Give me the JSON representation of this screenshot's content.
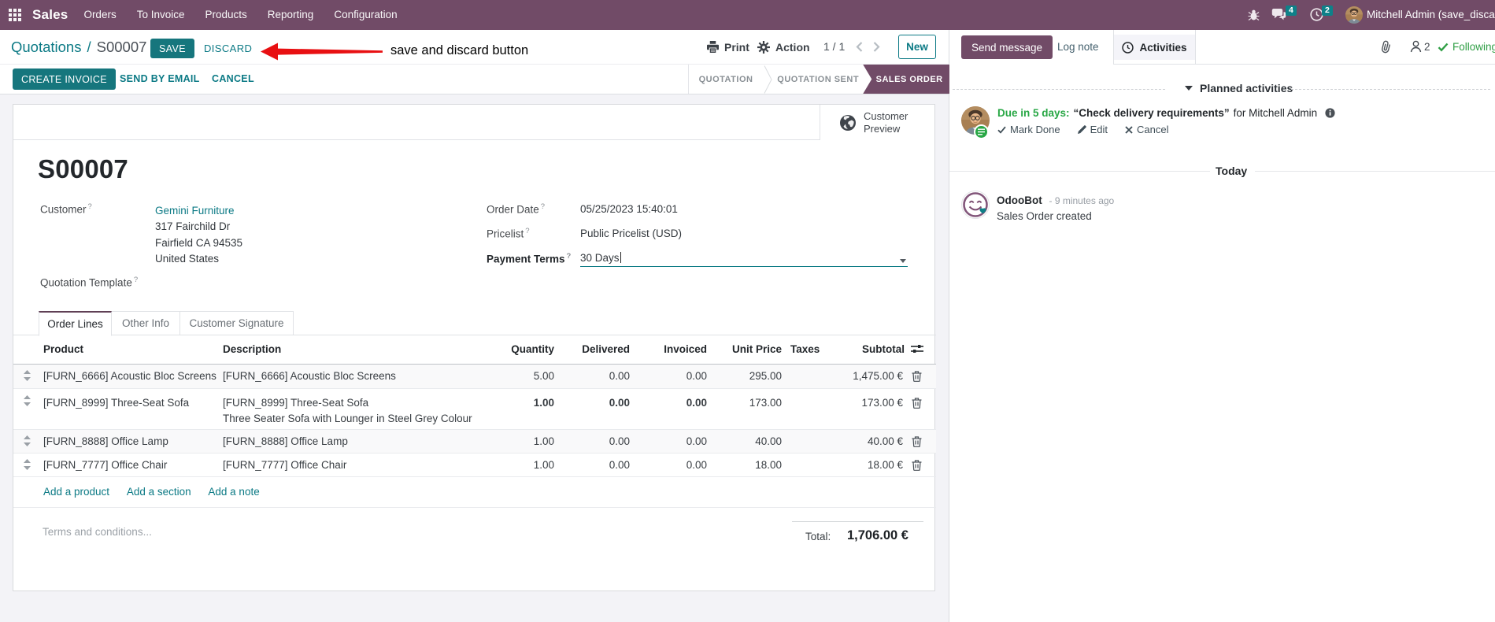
{
  "colors": {
    "brand_purple": "#714B67",
    "accent_teal": "#0c7a85",
    "button_teal": "#16767d",
    "modified_blue": "#1f87c5",
    "success_green": "#28a745",
    "annotation_red": "#e81012"
  },
  "nav": {
    "app_name": "Sales",
    "items": [
      "Orders",
      "To Invoice",
      "Products",
      "Reporting",
      "Configuration"
    ],
    "chat_badge": "4",
    "activity_badge": "2",
    "user_name": "Mitchell Admin (save_discard"
  },
  "control": {
    "breadcrumb_parent": "Quotations",
    "breadcrumb_sep": "/",
    "breadcrumb_current": "S00007",
    "save_label": "SAVE",
    "discard_label": "DISCARD",
    "print_label": "Print",
    "action_label": "Action",
    "pager": "1 / 1",
    "new_label": "New",
    "create_invoice_label": "CREATE INVOICE",
    "send_by_email_label": "SEND BY EMAIL",
    "cancel_label": "CANCEL"
  },
  "annotation": {
    "text": "save and discard button"
  },
  "statusbar": {
    "steps": [
      "QUOTATION",
      "QUOTATION SENT",
      "SALES ORDER"
    ],
    "active": "SALES ORDER"
  },
  "sheet": {
    "preview_label": "Customer Preview",
    "title": "S00007",
    "help_marker": "?",
    "customer": {
      "label": "Customer",
      "name": "Gemini Furniture",
      "address": [
        "317 Fairchild Dr",
        "Fairfield CA 94535",
        "United States"
      ]
    },
    "quotation_template_label": "Quotation Template",
    "order_date": {
      "label": "Order Date",
      "value": "05/25/2023 15:40:01"
    },
    "pricelist": {
      "label": "Pricelist",
      "value": "Public Pricelist (USD)"
    },
    "payment_terms": {
      "label": "Payment Terms",
      "value": "30 Days"
    }
  },
  "tabs": [
    "Order Lines",
    "Other Info",
    "Customer Signature"
  ],
  "table": {
    "headers": {
      "product": "Product",
      "description": "Description",
      "quantity": "Quantity",
      "delivered": "Delivered",
      "invoiced": "Invoiced",
      "unit_price": "Unit Price",
      "taxes": "Taxes",
      "subtotal": "Subtotal"
    },
    "rows": [
      {
        "product": "[FURN_6666] Acoustic Bloc Screens",
        "description": "[FURN_6666] Acoustic Bloc Screens",
        "description2": "",
        "quantity": "5.00",
        "delivered": "0.00",
        "invoiced": "0.00",
        "unit_price": "295.00",
        "taxes": "",
        "subtotal": "1,475.00 €"
      },
      {
        "product": "[FURN_8999] Three-Seat Sofa",
        "description": "[FURN_8999] Three-Seat Sofa",
        "description2": "Three Seater Sofa with Lounger in Steel Grey Colour",
        "quantity": "1.00",
        "delivered": "0.00",
        "invoiced": "0.00",
        "unit_price": "173.00",
        "taxes": "",
        "subtotal": "173.00 €"
      },
      {
        "product": "[FURN_8888] Office Lamp",
        "description": "[FURN_8888] Office Lamp",
        "description2": "",
        "quantity": "1.00",
        "delivered": "0.00",
        "invoiced": "0.00",
        "unit_price": "40.00",
        "taxes": "",
        "subtotal": "40.00 €"
      },
      {
        "product": "[FURN_7777] Office Chair",
        "description": "[FURN_7777] Office Chair",
        "description2": "",
        "quantity": "1.00",
        "delivered": "0.00",
        "invoiced": "0.00",
        "unit_price": "18.00",
        "taxes": "",
        "subtotal": "18.00 €"
      }
    ],
    "links": [
      "Add a product",
      "Add a section",
      "Add a note"
    ]
  },
  "footer": {
    "terms_placeholder": "Terms and conditions...",
    "total_label": "Total:",
    "total_value": "1,706.00 €"
  },
  "chatter": {
    "send_message": "Send message",
    "log_note": "Log note",
    "activities": "Activities",
    "followers_count": "2",
    "following": "Following",
    "planned_header": "Planned activities",
    "activity": {
      "due": "Due in 5 days:",
      "summary": "“Check delivery requirements”",
      "assignee": "for Mitchell Admin",
      "mark_done": "Mark Done",
      "edit": "Edit",
      "cancel": "Cancel"
    },
    "today": "Today",
    "message": {
      "author": "OdooBot",
      "time": "- 9 minutes ago",
      "body": "Sales Order created"
    }
  }
}
